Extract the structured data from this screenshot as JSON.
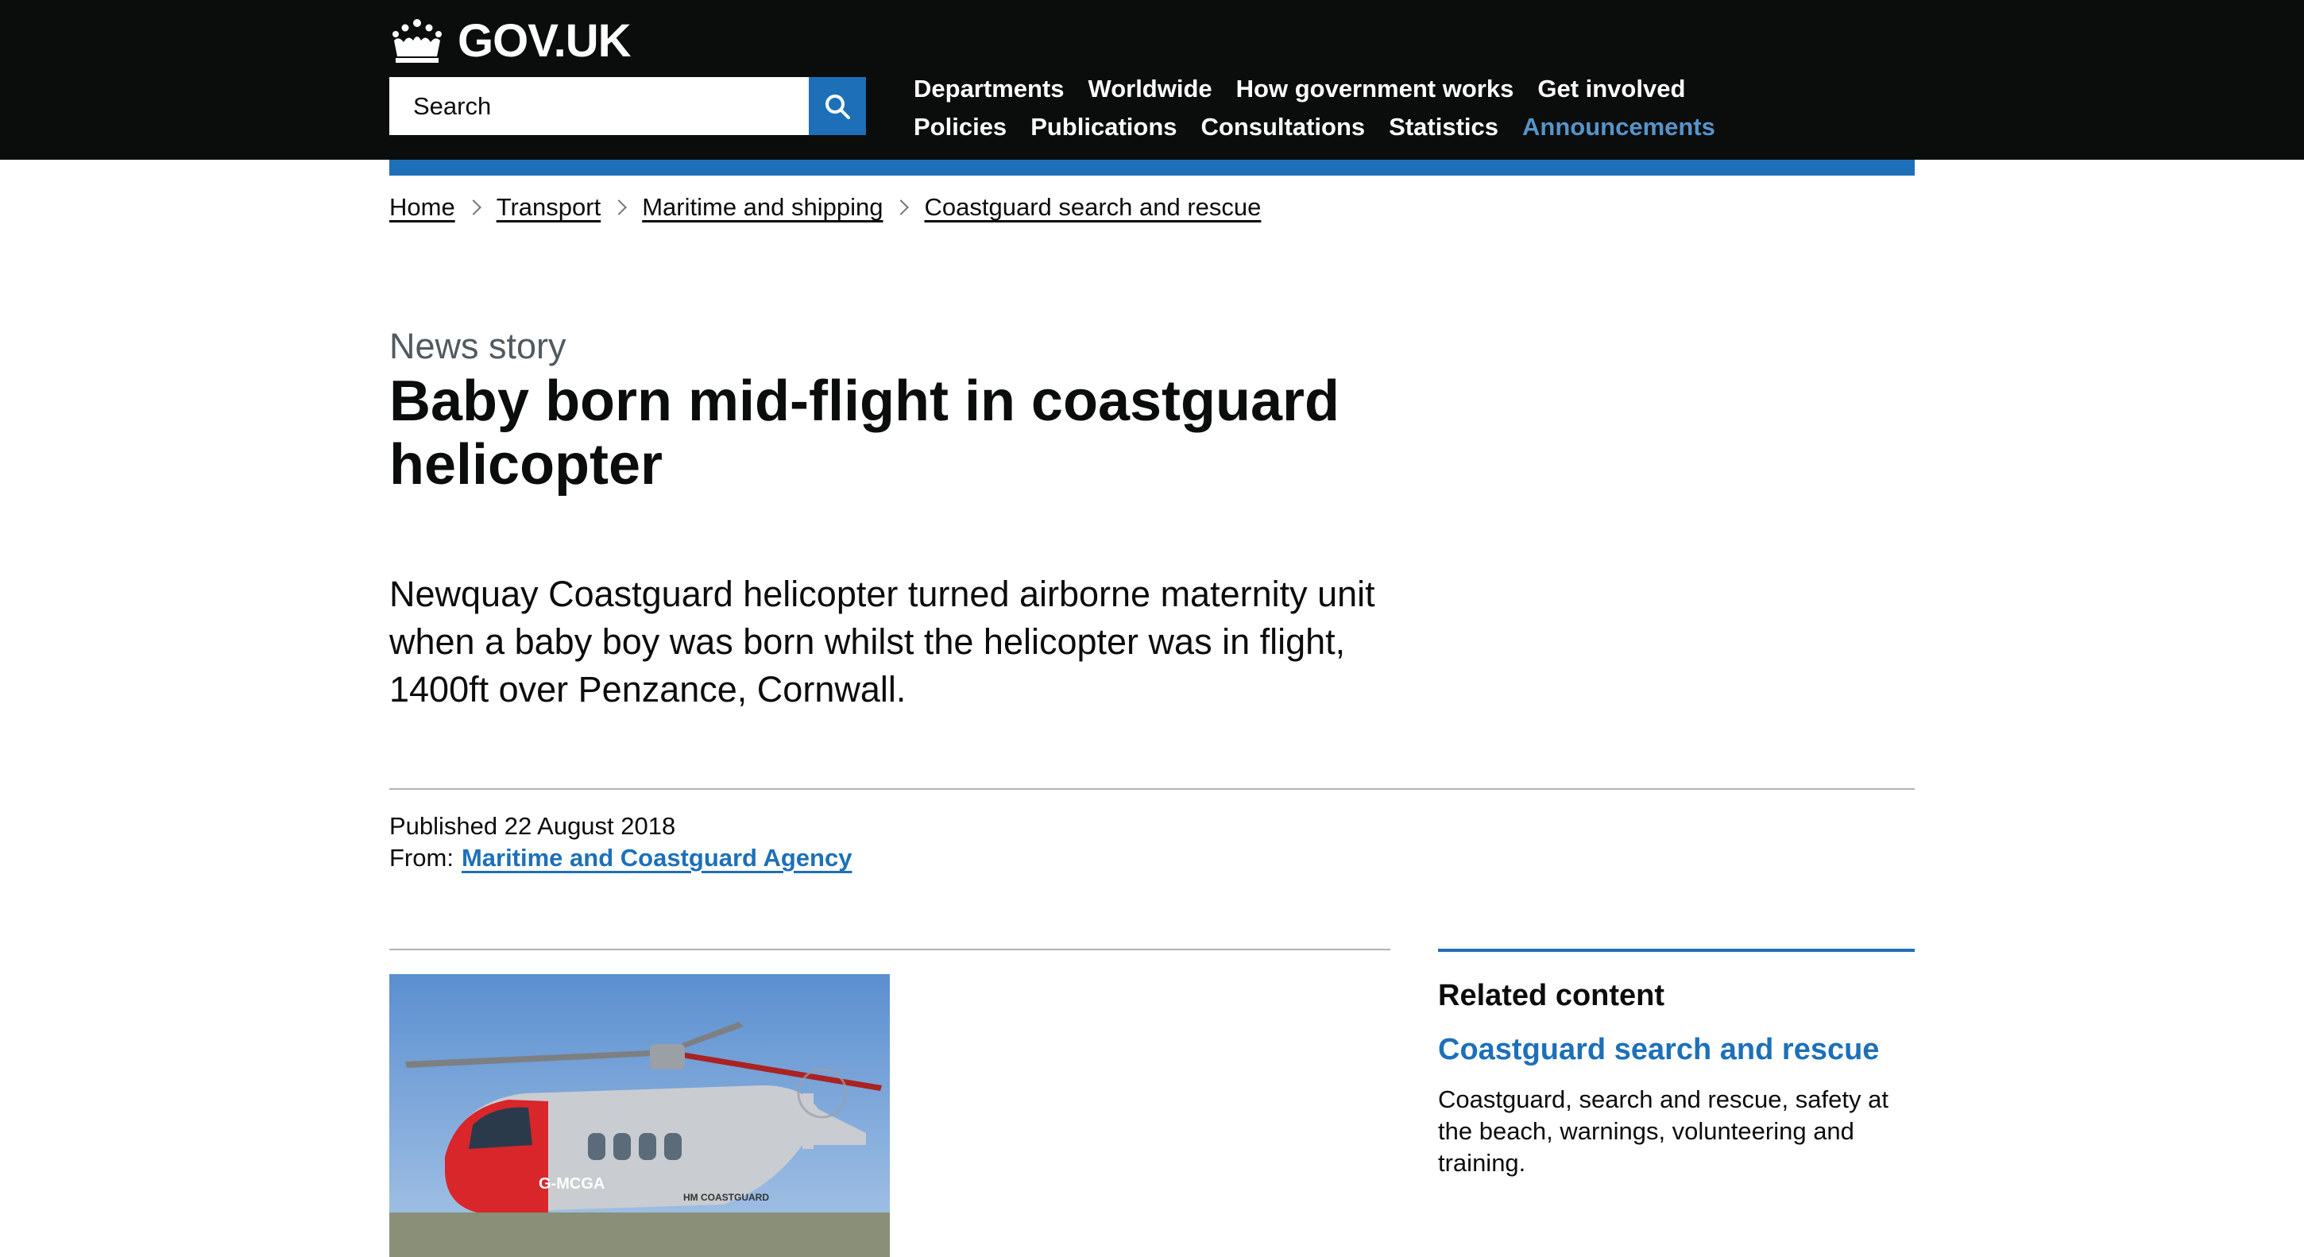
{
  "header": {
    "logo_text": "GOV.UK",
    "search_placeholder": "Search",
    "nav_row1": [
      "Departments",
      "Worldwide",
      "How government works",
      "Get involved"
    ],
    "nav_row2": [
      "Policies",
      "Publications",
      "Consultations",
      "Statistics",
      "Announcements"
    ],
    "active_item": "Announcements"
  },
  "breadcrumb": [
    "Home",
    "Transport",
    "Maritime and shipping",
    "Coastguard search and rescue"
  ],
  "article": {
    "caption": "News story",
    "title": "Baby born mid-flight in coastguard helicopter",
    "lead": "Newquay Coastguard helicopter turned airborne maternity unit when a baby boy was born whilst the helicopter was in flight, 1400ft over Penzance, Cornwall.",
    "published": "Published 22 August 2018",
    "from_label": "From:",
    "from_org": "Maritime and Coastguard Agency",
    "photo_markings": [
      "G-MCGA",
      "HM COASTGUARD"
    ]
  },
  "related": {
    "heading": "Related content",
    "link": "Coastguard search and rescue",
    "description": "Coastguard, search and rescue, safety at the beach, warnings, volunteering and training."
  },
  "colors": {
    "header_bg": "#0b0c0c",
    "brand_blue": "#1d70b8",
    "active_nav": "#5694ca",
    "caption_grey": "#505a5f"
  },
  "icons": [
    "crown-icon",
    "search-icon",
    "chevron-right-icon"
  ]
}
